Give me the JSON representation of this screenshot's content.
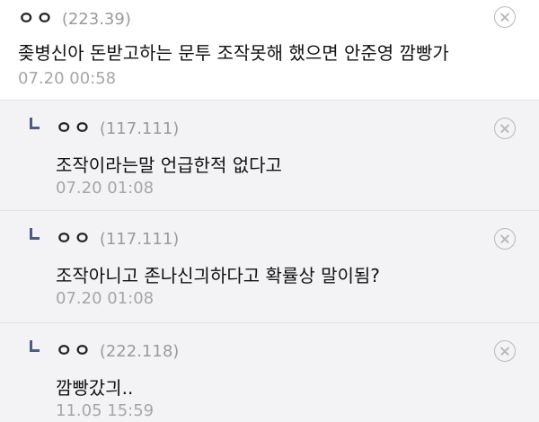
{
  "comments": [
    {
      "nickname": "ㅇㅇ",
      "ip": "(223.39)",
      "text": "좆병신아 돈받고하는 문투 조작못해 했으면 안준영 깜빵가",
      "date": "07.20 00:58"
    },
    {
      "nickname": "ㅇㅇ",
      "ip": "(117.111)",
      "text": "조작이라는말 언급한적 없다고",
      "date": "07.20 01:08"
    },
    {
      "nickname": "ㅇㅇ",
      "ip": "(117.111)",
      "text": "조작아니고 존나신긔하다고 확률상 말이됨?",
      "date": "07.20 01:08"
    },
    {
      "nickname": "ㅇㅇ",
      "ip": "(222.118)",
      "text": "깜빵갔긔..",
      "date": "11.05 15:59"
    }
  ],
  "icons": {
    "reply": "reply-arrow-icon",
    "delete": "close-circle-icon"
  },
  "colors": {
    "reply_mark": "#4f5a86",
    "meta_text": "#9a9a9f",
    "background": "#f3f3f5"
  }
}
